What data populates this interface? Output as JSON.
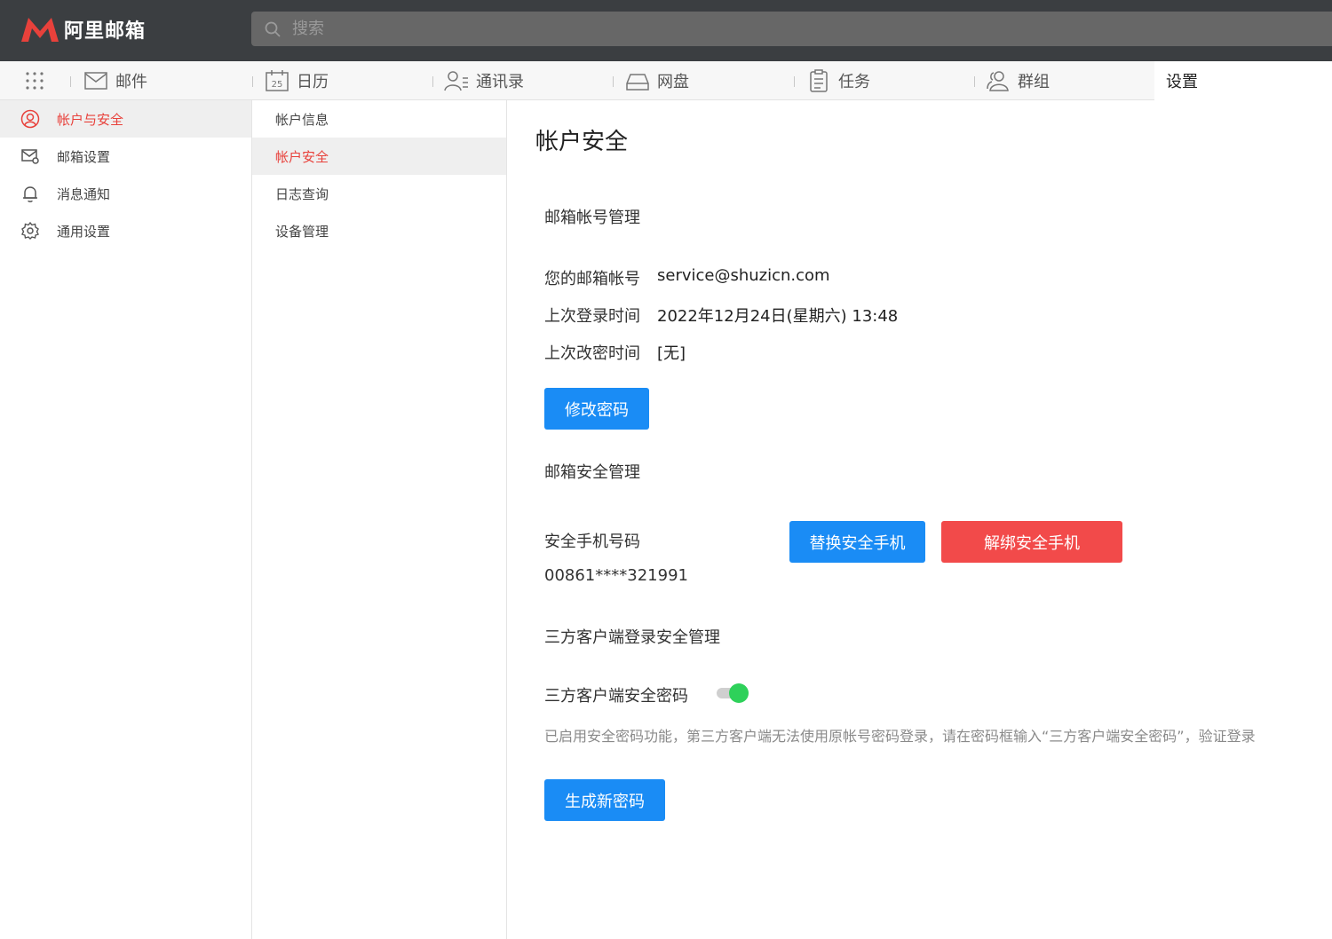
{
  "app": {
    "logo_text": "阿里邮箱",
    "brand_color": "#e8413b"
  },
  "search": {
    "placeholder": "搜索"
  },
  "nav": {
    "items": [
      {
        "label": "邮件",
        "icon": "mail-icon"
      },
      {
        "label": "日历",
        "icon": "calendar-icon",
        "badge": "25"
      },
      {
        "label": "通讯录",
        "icon": "contacts-icon"
      },
      {
        "label": "网盘",
        "icon": "drive-icon"
      },
      {
        "label": "任务",
        "icon": "task-icon"
      },
      {
        "label": "群组",
        "icon": "group-icon"
      }
    ],
    "active_label": "设置"
  },
  "sidebar": {
    "items": [
      {
        "label": "帐户与安全",
        "icon": "user-circle-icon",
        "active": true
      },
      {
        "label": "邮箱设置",
        "icon": "mail-settings-icon"
      },
      {
        "label": "消息通知",
        "icon": "bell-icon"
      },
      {
        "label": "通用设置",
        "icon": "gear-icon"
      }
    ]
  },
  "submenu": {
    "items": [
      {
        "label": "帐户信息"
      },
      {
        "label": "帐户安全",
        "active": true
      },
      {
        "label": "日志查询"
      },
      {
        "label": "设备管理"
      }
    ]
  },
  "main": {
    "title": "帐户安全",
    "account_section": {
      "title": "邮箱帐号管理",
      "email_label": "您的邮箱帐号",
      "email_value": "service@shuzicn.com",
      "last_login_label": "上次登录时间",
      "last_login_value": "2022年12月24日(星期六) 13:48",
      "last_pwd_label": "上次改密时间",
      "last_pwd_value": "[无]",
      "change_pwd_button": "修改密码"
    },
    "security_section": {
      "title": "邮箱安全管理",
      "phone_label": "安全手机号码",
      "phone_value": "00861****321991",
      "replace_button": "替换安全手机",
      "unbind_button": "解绑安全手机"
    },
    "client_section": {
      "title": "三方客户端登录安全管理",
      "toggle_label": "三方客户端安全密码",
      "toggle_on": true,
      "hint": "已启用安全密码功能，第三方客户端无法使用原帐号密码登录，请在密码框输入“三方客户端安全密码”，验证登录",
      "generate_button": "生成新密码"
    }
  }
}
